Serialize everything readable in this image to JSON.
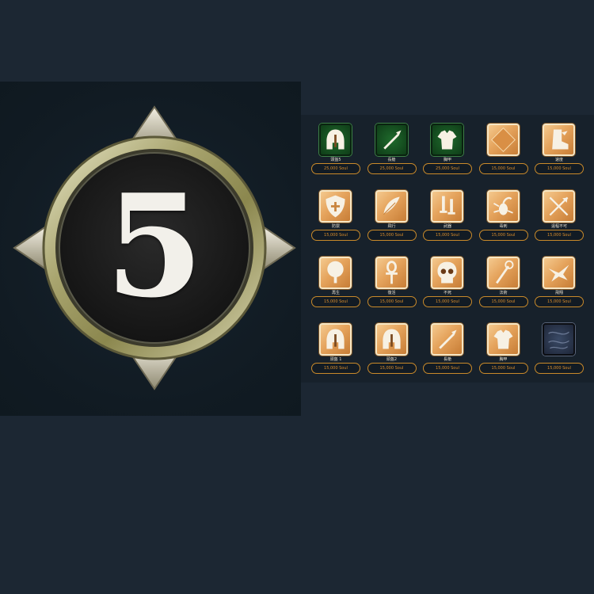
{
  "emblem": {
    "number": "5",
    "colors": {
      "ring": "#a39f6e",
      "disc": "#1c1c1c",
      "numeral": "#f2f0ea"
    }
  },
  "colors": {
    "accent": "#d98d2c",
    "gold_tile": "#e5a35c",
    "green_tile": "#155424"
  },
  "rewards": [
    {
      "icon": "helmet-icon",
      "style": "green",
      "label": "頭盔5",
      "price": "25,000 Soul"
    },
    {
      "icon": "spear-icon",
      "style": "green",
      "label": "長槍",
      "price": "25,000 Soul"
    },
    {
      "icon": "body-armor-icon",
      "style": "green",
      "label": "胸甲",
      "price": "25,000 Soul"
    },
    {
      "icon": "gem-icon",
      "style": "gold",
      "label": "",
      "price": "15,000 Soul"
    },
    {
      "icon": "boot-icon",
      "style": "gold",
      "label": "速度",
      "price": "15,000 Soul"
    },
    {
      "icon": "shield-icon",
      "style": "gold",
      "label": "防禦",
      "price": "15,000 Soul"
    },
    {
      "icon": "feather-icon",
      "style": "gold",
      "label": "飛行",
      "price": "15,000 Soul"
    },
    {
      "icon": "swords-icon",
      "style": "gold",
      "label": "武器",
      "price": "15,000 Soul"
    },
    {
      "icon": "scorpion-icon",
      "style": "gold",
      "label": "毒刺",
      "price": "15,000 Soul"
    },
    {
      "icon": "crossed-arrows-icon",
      "style": "gold",
      "label": "遠程不可",
      "price": "15,000 Soul"
    },
    {
      "icon": "tree-icon",
      "style": "gold",
      "label": "再生",
      "price": "15,000 Soul"
    },
    {
      "icon": "ankh-icon",
      "style": "gold",
      "label": "復活",
      "price": "15,000 Soul"
    },
    {
      "icon": "skull-icon",
      "style": "gold",
      "label": "不死",
      "price": "15,000 Soul"
    },
    {
      "icon": "staff-icon",
      "style": "gold",
      "label": "法術",
      "price": "15,000 Soul"
    },
    {
      "icon": "bird-icon",
      "style": "gold",
      "label": "飛翔",
      "price": "15,000 Soul"
    },
    {
      "icon": "helmet-icon",
      "style": "gold",
      "label": "頭盔 1",
      "price": "15,000 Soul"
    },
    {
      "icon": "helmet-icon",
      "style": "gold",
      "label": "頭盔2",
      "price": "15,000 Soul"
    },
    {
      "icon": "spear-icon",
      "style": "gold",
      "label": "長槍",
      "price": "15,000 Soul"
    },
    {
      "icon": "body-armor-icon",
      "style": "gold",
      "label": "胸甲",
      "price": "15,000 Soul"
    },
    {
      "icon": "dark-texture-icon",
      "style": "dark",
      "label": "",
      "price": "15,000 Soul"
    }
  ]
}
